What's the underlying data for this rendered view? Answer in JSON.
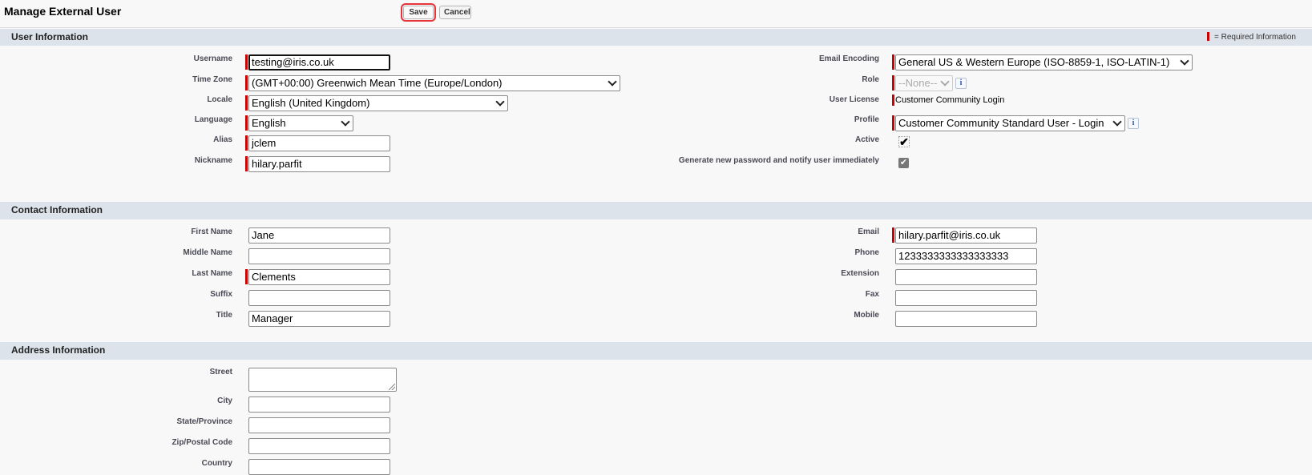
{
  "header": {
    "title": "Manage External User",
    "save_label": "Save",
    "cancel_label": "Cancel"
  },
  "sections": {
    "user_info": {
      "title": "User Information",
      "required_legend": "= Required Information",
      "username": {
        "label": "Username",
        "value": "testing@iris.co.uk"
      },
      "time_zone": {
        "label": "Time Zone",
        "value": "(GMT+00:00) Greenwich Mean Time (Europe/London)"
      },
      "locale": {
        "label": "Locale",
        "value": "English (United Kingdom)"
      },
      "language": {
        "label": "Language",
        "value": "English"
      },
      "alias": {
        "label": "Alias",
        "value": "jclem"
      },
      "nickname": {
        "label": "Nickname",
        "value": "hilary.parfit"
      },
      "email_encoding": {
        "label": "Email Encoding",
        "value": "General US & Western Europe (ISO-8859-1, ISO-LATIN-1)"
      },
      "role": {
        "label": "Role",
        "value": "--None--"
      },
      "user_license": {
        "label": "User License",
        "value": "Customer Community Login"
      },
      "profile": {
        "label": "Profile",
        "value": "Customer Community Standard User - Login"
      },
      "active": {
        "label": "Active",
        "checked": true
      },
      "generate_password": {
        "label": "Generate new password and notify user immediately",
        "checked": true
      },
      "info_glyph": "i",
      "check_glyph": "✔"
    },
    "contact_info": {
      "title": "Contact Information",
      "first_name": {
        "label": "First Name",
        "value": "Jane"
      },
      "middle_name": {
        "label": "Middle Name",
        "value": ""
      },
      "last_name": {
        "label": "Last Name",
        "value": "Clements"
      },
      "suffix": {
        "label": "Suffix",
        "value": ""
      },
      "title_field": {
        "label": "Title",
        "value": "Manager"
      },
      "email": {
        "label": "Email",
        "value": "hilary.parfit@iris.co.uk"
      },
      "phone": {
        "label": "Phone",
        "value": "1233333333333333333"
      },
      "extension": {
        "label": "Extension",
        "value": ""
      },
      "fax": {
        "label": "Fax",
        "value": ""
      },
      "mobile": {
        "label": "Mobile",
        "value": ""
      }
    },
    "address_info": {
      "title": "Address Information",
      "street": {
        "label": "Street",
        "value": ""
      },
      "city": {
        "label": "City",
        "value": ""
      },
      "state": {
        "label": "State/Province",
        "value": ""
      },
      "zip": {
        "label": "Zip/Postal Code",
        "value": ""
      },
      "country": {
        "label": "Country",
        "value": ""
      }
    }
  },
  "colors": {
    "required_bar": "#cc0000",
    "section_band": "#dce3ea",
    "save_highlight": "#e8333b",
    "info_icon": "#2a5aa8"
  }
}
